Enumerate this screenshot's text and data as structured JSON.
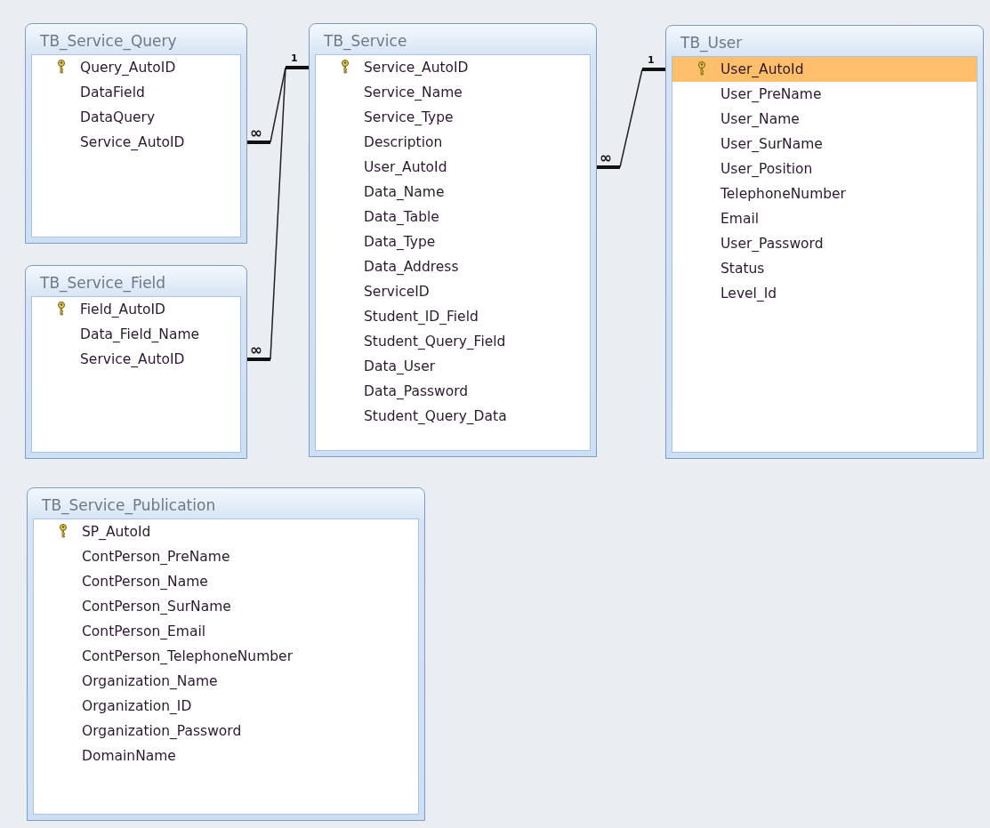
{
  "tables": [
    {
      "name": "TB_Service_Query",
      "fields": [
        {
          "name": "Query_AutoID",
          "key": true,
          "selected": false
        },
        {
          "name": "DataField",
          "key": false,
          "selected": false
        },
        {
          "name": "DataQuery",
          "key": false,
          "selected": false
        },
        {
          "name": "Service_AutoID",
          "key": false,
          "selected": false
        }
      ]
    },
    {
      "name": "TB_Service",
      "fields": [
        {
          "name": "Service_AutoID",
          "key": true,
          "selected": false
        },
        {
          "name": "Service_Name",
          "key": false,
          "selected": false
        },
        {
          "name": "Service_Type",
          "key": false,
          "selected": false
        },
        {
          "name": "Description",
          "key": false,
          "selected": false
        },
        {
          "name": "User_AutoId",
          "key": false,
          "selected": false
        },
        {
          "name": "Data_Name",
          "key": false,
          "selected": false
        },
        {
          "name": "Data_Table",
          "key": false,
          "selected": false
        },
        {
          "name": "Data_Type",
          "key": false,
          "selected": false
        },
        {
          "name": "Data_Address",
          "key": false,
          "selected": false
        },
        {
          "name": "ServiceID",
          "key": false,
          "selected": false
        },
        {
          "name": "Student_ID_Field",
          "key": false,
          "selected": false
        },
        {
          "name": "Student_Query_Field",
          "key": false,
          "selected": false
        },
        {
          "name": "Data_User",
          "key": false,
          "selected": false
        },
        {
          "name": "Data_Password",
          "key": false,
          "selected": false
        },
        {
          "name": "Student_Query_Data",
          "key": false,
          "selected": false
        }
      ]
    },
    {
      "name": "TB_User",
      "fields": [
        {
          "name": "User_AutoId",
          "key": true,
          "selected": true
        },
        {
          "name": "User_PreName",
          "key": false,
          "selected": false
        },
        {
          "name": "User_Name",
          "key": false,
          "selected": false
        },
        {
          "name": "User_SurName",
          "key": false,
          "selected": false
        },
        {
          "name": "User_Position",
          "key": false,
          "selected": false
        },
        {
          "name": "TelephoneNumber",
          "key": false,
          "selected": false
        },
        {
          "name": "Email",
          "key": false,
          "selected": false
        },
        {
          "name": "User_Password",
          "key": false,
          "selected": false
        },
        {
          "name": "Status",
          "key": false,
          "selected": false
        },
        {
          "name": "Level_Id",
          "key": false,
          "selected": false
        }
      ]
    },
    {
      "name": "TB_Service_Field",
      "fields": [
        {
          "name": "Field_AutoID",
          "key": true,
          "selected": false
        },
        {
          "name": "Data_Field_Name",
          "key": false,
          "selected": false
        },
        {
          "name": "Service_AutoID",
          "key": false,
          "selected": false
        }
      ]
    },
    {
      "name": "TB_Service_Publication",
      "fields": [
        {
          "name": "SP_AutoId",
          "key": true,
          "selected": false
        },
        {
          "name": "ContPerson_PreName",
          "key": false,
          "selected": false
        },
        {
          "name": "ContPerson_Name",
          "key": false,
          "selected": false
        },
        {
          "name": "ContPerson_SurName",
          "key": false,
          "selected": false
        },
        {
          "name": "ContPerson_Email",
          "key": false,
          "selected": false
        },
        {
          "name": "ContPerson_TelephoneNumber",
          "key": false,
          "selected": false
        },
        {
          "name": "Organization_Name",
          "key": false,
          "selected": false
        },
        {
          "name": "Organization_ID",
          "key": false,
          "selected": false
        },
        {
          "name": "Organization_Password",
          "key": false,
          "selected": false
        },
        {
          "name": "DomainName",
          "key": false,
          "selected": false
        }
      ]
    }
  ],
  "relationships": [
    {
      "one_label": "1",
      "many_label": "∞"
    },
    {
      "many_label": "∞"
    },
    {
      "one_label": "1",
      "many_label": "∞"
    }
  ]
}
